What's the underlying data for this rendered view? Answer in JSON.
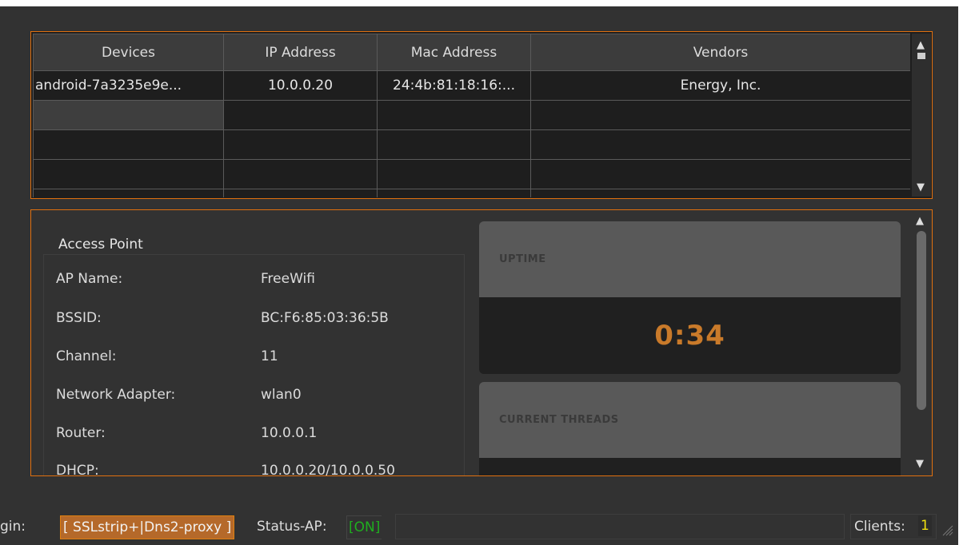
{
  "devices_table": {
    "columns": [
      "Devices",
      "IP Address",
      "Mac Address",
      "Vendors"
    ],
    "rows": [
      [
        "android-7a3235e9e...",
        "10.0.0.20",
        "24:4b:81:18:16:...",
        "Energy, Inc."
      ]
    ]
  },
  "access_point": {
    "title": "Access Point",
    "labels": {
      "ap_name": "AP Name:",
      "bssid": "BSSID:",
      "channel": "Channel:",
      "network_adapter": "Network Adapter:",
      "router": "Router:",
      "dhcp": "DHCP:"
    },
    "values": {
      "ap_name": "FreeWifi",
      "bssid": "BC:F6:85:03:36:5B",
      "channel": "11",
      "network_adapter": "wlan0",
      "router": "10.0.0.1",
      "dhcp": "10.0.0.20/10.0.0.50"
    }
  },
  "uptime": {
    "title": "UPTIME",
    "value": "0:34"
  },
  "current_threads": {
    "title": "CURRENT THREADS"
  },
  "status_bar": {
    "plugin_label": "gin:",
    "plugin_value": "[ SSLstrip+|Dns2-proxy ]",
    "status_ap_label": "Status-AP:",
    "status_ap_value": "[ON]",
    "clients_label": "Clients:",
    "clients_count": "1"
  },
  "colors": {
    "accent_border": "#e0700f",
    "uptime_value": "#c97a2a",
    "status_on": "#1fae1f",
    "clients_count": "#f0e010"
  }
}
